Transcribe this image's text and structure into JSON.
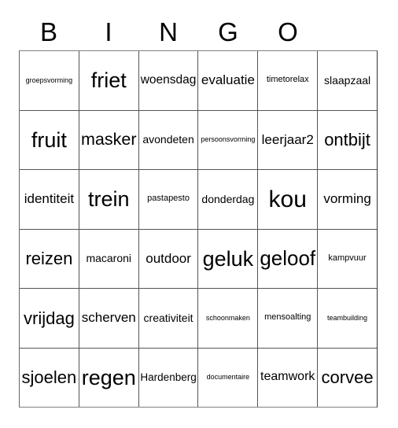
{
  "card": {
    "header_letters": [
      "B",
      "I",
      "N",
      "G",
      "O",
      ""
    ],
    "columns": 6,
    "rows": 6,
    "grid": [
      [
        {
          "label": "groepsvorming",
          "size": "xxs"
        },
        {
          "label": "friet",
          "size": "xl"
        },
        {
          "label": "woensdag",
          "size": "m"
        },
        {
          "label": "evaluatie",
          "size": "m"
        },
        {
          "label": "timetorelax",
          "size": "xs"
        },
        {
          "label": "slaapzaal",
          "size": "s"
        }
      ],
      [
        {
          "label": "fruit",
          "size": "xl"
        },
        {
          "label": "masker",
          "size": "l"
        },
        {
          "label": "avondeten",
          "size": "s"
        },
        {
          "label": "persoonsvorming",
          "size": "xxs"
        },
        {
          "label": "leerjaar2",
          "size": "m"
        },
        {
          "label": "ontbijt",
          "size": "l"
        }
      ],
      [
        {
          "label": "identiteit",
          "size": "m"
        },
        {
          "label": "trein",
          "size": "xl"
        },
        {
          "label": "pastapesto",
          "size": "xs"
        },
        {
          "label": "donderdag",
          "size": "s"
        },
        {
          "label": "kou",
          "size": "xxl"
        },
        {
          "label": "vorming",
          "size": "m"
        }
      ],
      [
        {
          "label": "reizen",
          "size": "l"
        },
        {
          "label": "macaroni",
          "size": "s"
        },
        {
          "label": "outdoor",
          "size": "m"
        },
        {
          "label": "geluk",
          "size": "xl"
        },
        {
          "label": "geloof",
          "size": "xl"
        },
        {
          "label": "kampvuur",
          "size": "xs"
        }
      ],
      [
        {
          "label": "vrijdag",
          "size": "l"
        },
        {
          "label": "scherven",
          "size": "m"
        },
        {
          "label": "creativiteit",
          "size": "s"
        },
        {
          "label": "schoonmaken",
          "size": "xxs"
        },
        {
          "label": "mensoalting",
          "size": "xs"
        },
        {
          "label": "teambuilding",
          "size": "xxs"
        }
      ],
      [
        {
          "label": "sjoelen",
          "size": "l"
        },
        {
          "label": "regen",
          "size": "xl"
        },
        {
          "label": "Hardenberg",
          "size": "s"
        },
        {
          "label": "documentaire",
          "size": "xxs"
        },
        {
          "label": "teamwork",
          "size": "m"
        },
        {
          "label": "corvee",
          "size": "l"
        }
      ]
    ]
  },
  "colors": {
    "background": "#ffffff",
    "text": "#000000",
    "grid_line": "#555555",
    "grid_border": "#808080"
  }
}
